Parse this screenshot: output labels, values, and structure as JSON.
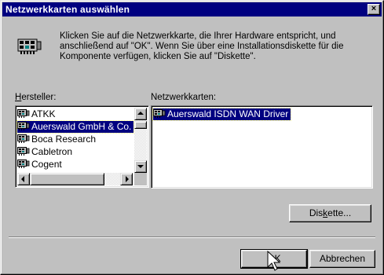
{
  "window": {
    "title": "Netzwerkkarten auswählen",
    "close_glyph": "×"
  },
  "info": {
    "icon": "network-card-icon",
    "text": "Klicken Sie auf die Netzwerkkarte, die Ihrer Hardware entspricht, und anschließend auf \"OK\".  Wenn Sie über eine Installationsdiskette für die Komponente verfügen, klicken Sie auf \"Diskette\"."
  },
  "manufacturers": {
    "label_hotkey": "H",
    "label_rest": "ersteller:",
    "items": [
      {
        "label": "ATKK",
        "icon": "network-card-icon",
        "selected": false
      },
      {
        "label": "Auerswald GmbH & Co.",
        "icon": "network-card-icon",
        "selected": true
      },
      {
        "label": "Boca Research",
        "icon": "network-card-icon",
        "selected": false
      },
      {
        "label": "Cabletron",
        "icon": "network-card-icon",
        "selected": false
      },
      {
        "label": "Cogent",
        "icon": "network-card-icon",
        "selected": false
      }
    ]
  },
  "network_cards": {
    "label": "Netzwerkkarten:",
    "items": [
      {
        "label": "Auerswald ISDN WAN Driver",
        "icon": "network-card-icon",
        "selected": true
      }
    ]
  },
  "buttons": {
    "disk_pre": "Dis",
    "disk_hotkey": "k",
    "disk_post": "ette...",
    "ok": "OK",
    "cancel": "Abbrechen"
  },
  "colors": {
    "titlebar": "#000080",
    "selection": "#000080",
    "face": "#c0c0c0"
  }
}
